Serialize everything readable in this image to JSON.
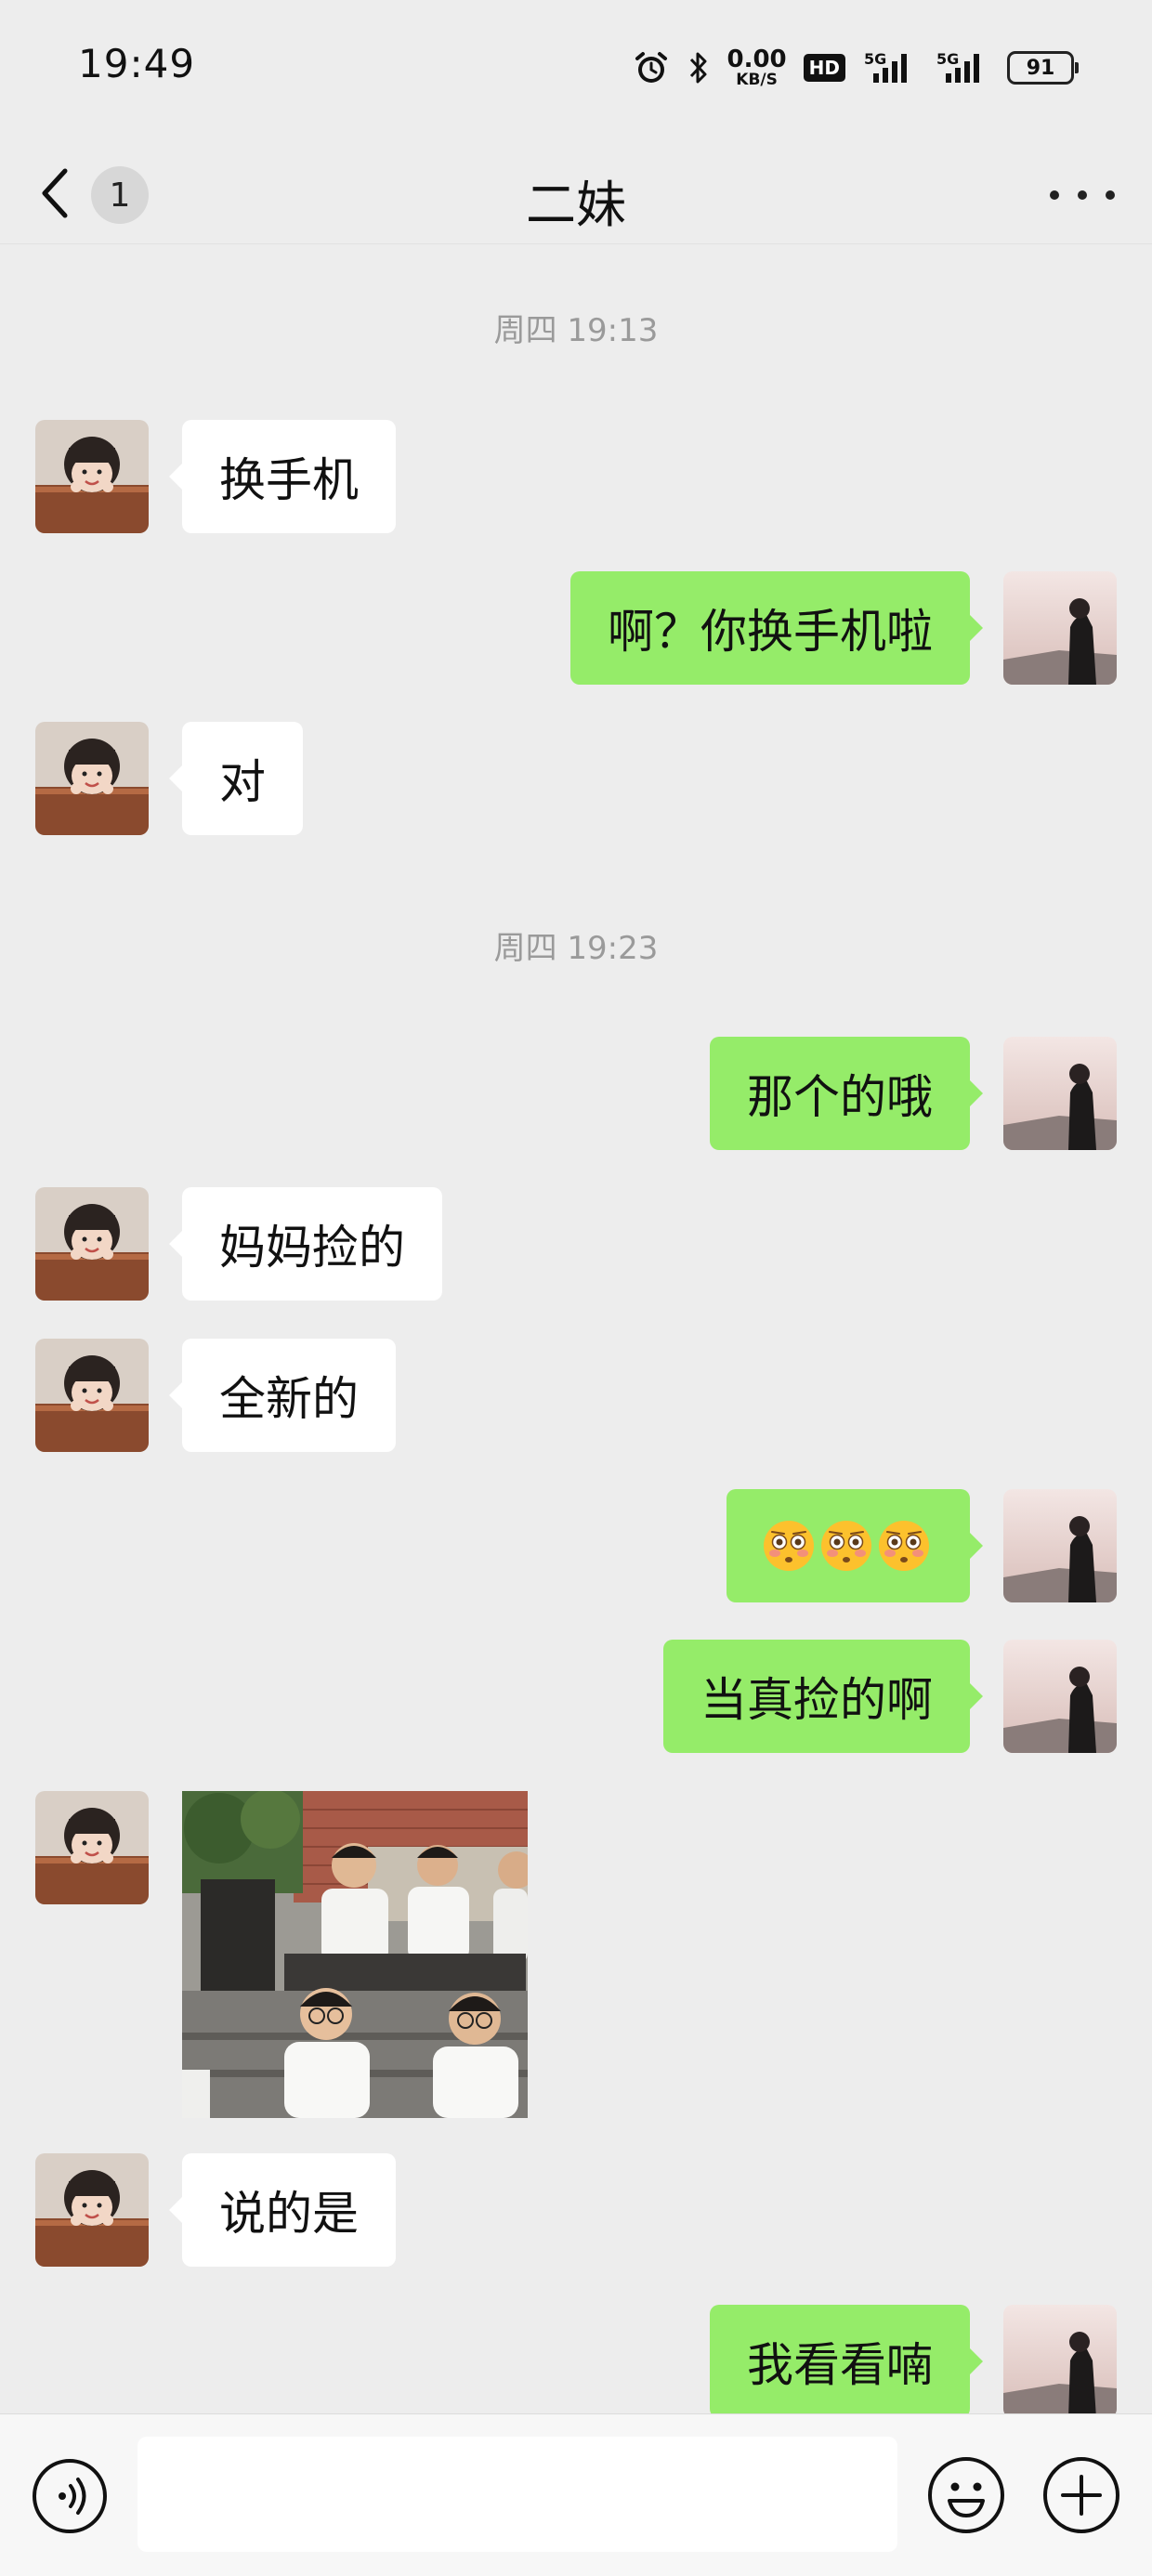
{
  "status_bar": {
    "time": "19:49",
    "net_speed_value": "0.00",
    "net_speed_unit": "KB/S",
    "hd_label": "HD",
    "signal_1": "5G",
    "signal_2": "5G",
    "battery": "91",
    "icons": [
      "alarm-icon",
      "bluetooth-icon",
      "hd-icon",
      "signal-5g-icon",
      "signal-5g-icon",
      "battery-icon"
    ]
  },
  "header": {
    "unread_count": "1",
    "title": "二妹"
  },
  "messages": {
    "ts1": "周四 19:13",
    "m1": "换手机",
    "m2": "啊？你换手机啦",
    "m3": "对",
    "ts2": "周四 19:23",
    "m4": "那个的哦",
    "m5": "妈妈捡的",
    "m6": "全新的",
    "m7_emoji": "flushed-face x3",
    "m8": "当真捡的啊",
    "m9_image": "photo",
    "m10": "说的是",
    "m11": "我看看喃"
  },
  "input_bar": {
    "text_value": "",
    "icons": [
      "voice-icon",
      "emoji-icon",
      "plus-icon"
    ]
  },
  "colors": {
    "background": "#ededed",
    "bubble_self": "#95ec69",
    "bubble_other": "#ffffff",
    "timestamp": "#9a9a9a"
  }
}
